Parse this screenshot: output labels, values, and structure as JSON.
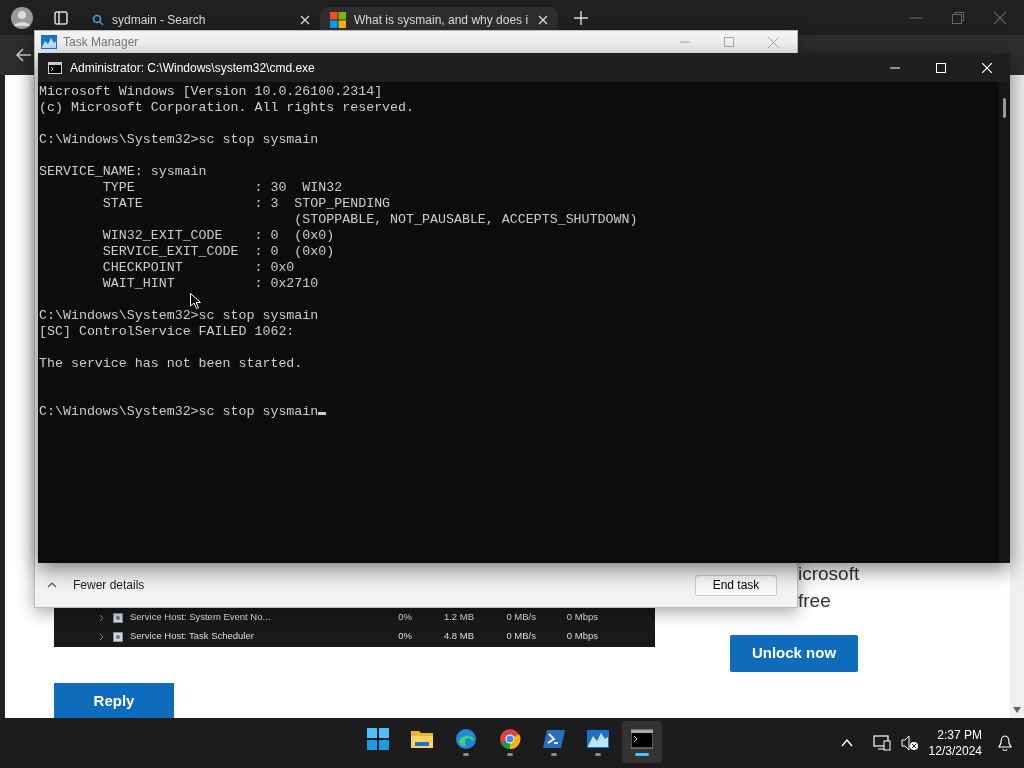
{
  "browser": {
    "tabs": [
      {
        "label": "sydmain - Search",
        "kind": "search",
        "selected": false
      },
      {
        "label": "What is sysmain, and why does i",
        "kind": "site",
        "selected": true
      }
    ]
  },
  "web_page": {
    "screenshot_rows": [
      {
        "name": "Service Host: System Event No...",
        "cpu": "0%",
        "memory": "1.2 MB",
        "disk": "0 MB/s",
        "network": "0 Mbps"
      },
      {
        "name": "Service Host: Task Scheduler",
        "cpu": "0%",
        "memory": "4.8 MB",
        "disk": "0 MB/s",
        "network": "0 Mbps"
      }
    ],
    "promo_lines": [
      "icrosoft",
      "free"
    ],
    "unlock_button": "Unlock now",
    "reply_button": "Reply"
  },
  "task_manager": {
    "title": "Task Manager",
    "details_toggle": "Fewer details",
    "end_task_button": "End task"
  },
  "cmd_window": {
    "title": "Administrator: C:\\Windows\\system32\\cmd.exe",
    "blocks": [
      {
        "lines": [
          "Microsoft Windows [Version 10.0.26100.2314]",
          "(c) Microsoft Corporation. All rights reserved."
        ]
      },
      {
        "lines": [
          "C:\\Windows\\System32>sc stop sysmain"
        ]
      },
      {
        "lines": [
          "SERVICE_NAME: sysmain",
          "        TYPE               : 30  WIN32",
          "        STATE              : 3  STOP_PENDING",
          "                                (STOPPABLE, NOT_PAUSABLE, ACCEPTS_SHUTDOWN)",
          "        WIN32_EXIT_CODE    : 0  (0x0)",
          "        SERVICE_EXIT_CODE  : 0  (0x0)",
          "        CHECKPOINT         : 0x0",
          "        WAIT_HINT          : 0x2710"
        ]
      },
      {
        "lines": [
          "C:\\Windows\\System32>sc stop sysmain",
          "[SC] ControlService FAILED 1062:"
        ]
      },
      {
        "lines": [
          "The service has not been started."
        ]
      }
    ],
    "prompt": {
      "text": "C:\\Windows\\System32>sc stop sysmain",
      "cursor": true
    }
  },
  "taskbar": {
    "apps": [
      {
        "kind": "start",
        "running": false,
        "selected": false
      },
      {
        "kind": "explorer",
        "running": false,
        "selected": false
      },
      {
        "kind": "edge",
        "running": true,
        "selected": false
      },
      {
        "kind": "chrome",
        "running": true,
        "selected": false
      },
      {
        "kind": "powershell",
        "running": true,
        "selected": false
      },
      {
        "kind": "taskmanager",
        "running": true,
        "selected": false
      },
      {
        "kind": "cmd",
        "running": true,
        "selected": true
      }
    ],
    "time": "2:37 PM",
    "date": "12/3/2024"
  }
}
